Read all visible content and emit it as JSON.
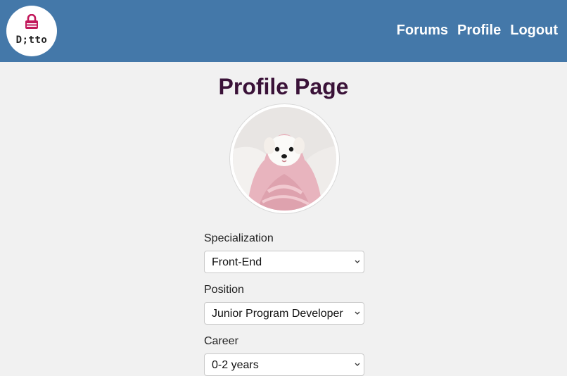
{
  "app": {
    "logo_text": "D;tto",
    "brand_color": "#4478a9"
  },
  "nav": {
    "items": [
      {
        "label": "Forums"
      },
      {
        "label": "Profile"
      },
      {
        "label": "Logout"
      }
    ]
  },
  "page": {
    "title": "Profile Page"
  },
  "profile": {
    "avatar": "puppy-in-pink-blanket"
  },
  "form": {
    "fields": [
      {
        "label": "Specialization",
        "value": "Front-End"
      },
      {
        "label": "Position",
        "value": "Junior Program Developer"
      },
      {
        "label": "Career",
        "value": "0-2 years"
      }
    ]
  },
  "icons": {
    "logo": "lock-icon",
    "select_arrow": "chevron-down-icon"
  }
}
